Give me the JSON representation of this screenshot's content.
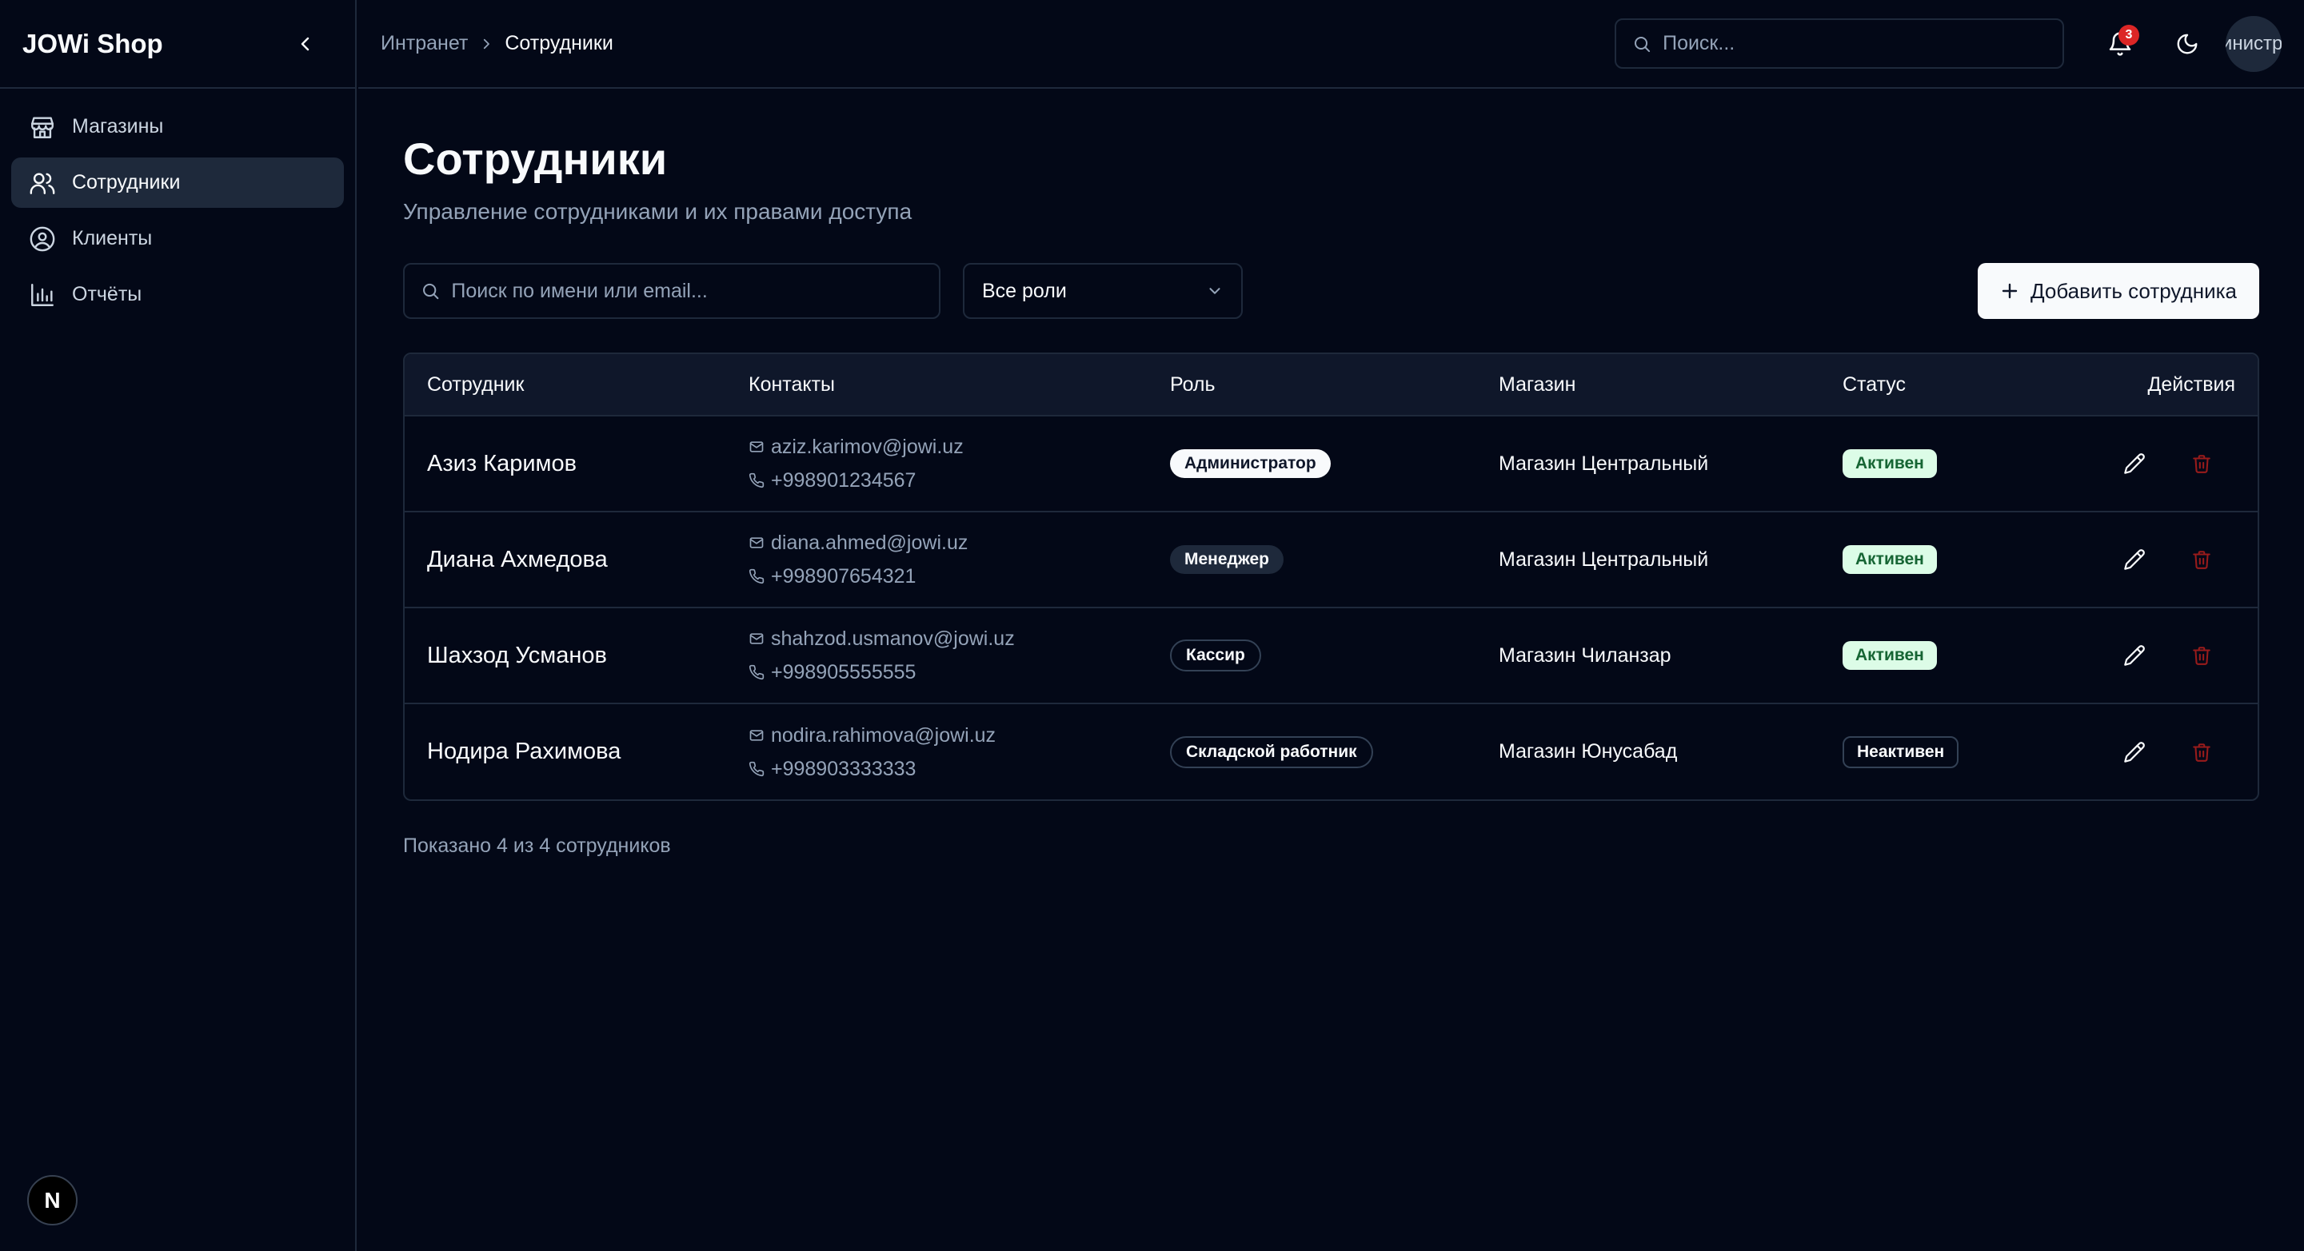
{
  "app": {
    "brand": "JOWi Shop"
  },
  "sidebar": {
    "items": [
      {
        "label": "Магазины",
        "icon": "store-icon",
        "active": false
      },
      {
        "label": "Сотрудники",
        "icon": "users-icon",
        "active": true
      },
      {
        "label": "Клиенты",
        "icon": "user-circle-icon",
        "active": false
      },
      {
        "label": "Отчёты",
        "icon": "bar-chart-icon",
        "active": false
      }
    ],
    "next_badge": "N"
  },
  "header": {
    "breadcrumb": {
      "parent": "Интранет",
      "current": "Сотрудники"
    },
    "search_placeholder": "Поиск...",
    "notifications_count": "3",
    "avatar_text": "Администратор"
  },
  "page": {
    "title": "Сотрудники",
    "subtitle": "Управление сотрудниками и их правами доступа",
    "search_placeholder": "Поиск по имени или email...",
    "role_filter": "Все роли",
    "add_button": "Добавить сотрудника"
  },
  "table": {
    "headers": {
      "employee": "Сотрудник",
      "contacts": "Контакты",
      "role": "Роль",
      "store": "Магазин",
      "status": "Статус",
      "actions": "Действия"
    },
    "rows": [
      {
        "name": "Азиз Каримов",
        "email": "aziz.karimov@jowi.uz",
        "phone": "+998901234567",
        "role": "Администратор",
        "store": "Магазин Центральный",
        "status": "Активен"
      },
      {
        "name": "Диана Ахмедова",
        "email": "diana.ahmed@jowi.uz",
        "phone": "+998907654321",
        "role": "Менеджер",
        "store": "Магазин Центральный",
        "status": "Активен"
      },
      {
        "name": "Шахзод Усманов",
        "email": "shahzod.usmanov@jowi.uz",
        "phone": "+998905555555",
        "role": "Кассир",
        "store": "Магазин Чиланзар",
        "status": "Активен"
      },
      {
        "name": "Нодира Рахимова",
        "email": "nodira.rahimova@jowi.uz",
        "phone": "+998903333333",
        "role": "Складской работник",
        "store": "Магазин Юнусабад",
        "status": "Неактивен"
      }
    ],
    "footer": "Показано 4 из 4 сотрудников"
  },
  "colors": {
    "background": "#030817",
    "border": "#1e293b",
    "muted_text": "#94a3b8",
    "active_badge_bg": "#dcfce7",
    "active_badge_text": "#166534",
    "delete_icon": "#991b1b",
    "notification_badge": "#dc2626"
  }
}
